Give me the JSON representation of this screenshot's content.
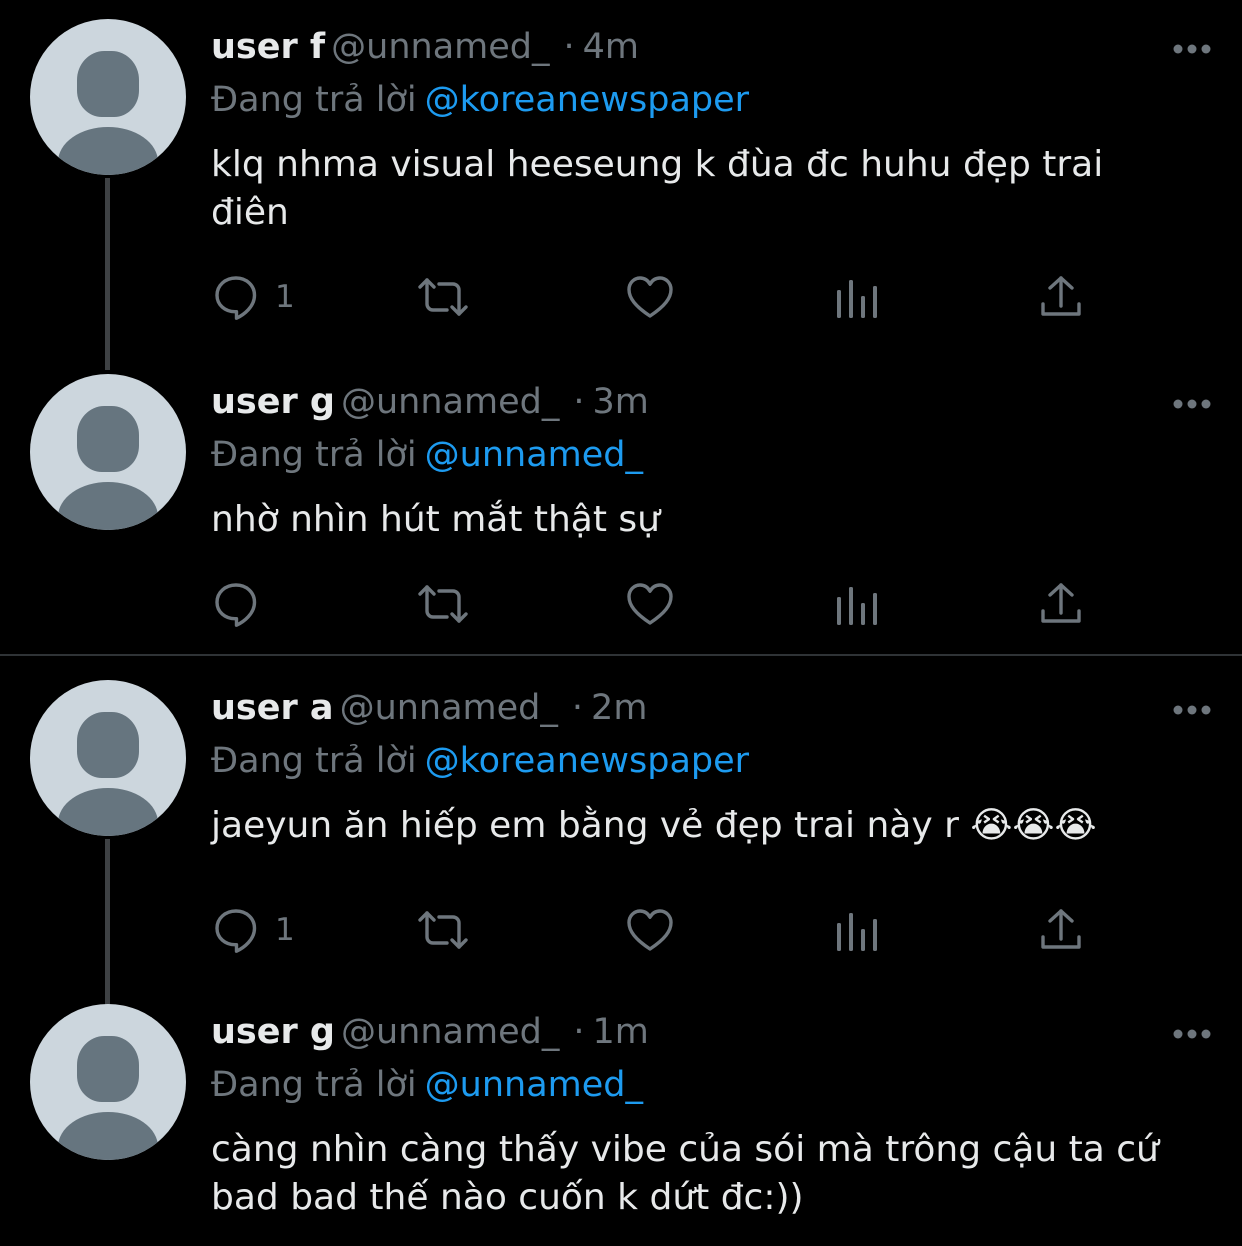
{
  "tweets": [
    {
      "name": "user f",
      "handle": "@unnamed_",
      "time": "4m",
      "reply_prefix": "Đang trả lời",
      "reply_to": "@koreanewspaper",
      "text": "klq nhma visual heeseung k đùa đc huhu đẹp trai điên",
      "reply_count": "1"
    },
    {
      "name": "user g",
      "handle": "@unnamed_",
      "time": "3m",
      "reply_prefix": "Đang trả lời",
      "reply_to": "@unnamed_",
      "text": "nhờ nhìn hút mắt thật sự",
      "reply_count": ""
    },
    {
      "name": "user a",
      "handle": "@unnamed_",
      "time": "2m",
      "reply_prefix": "Đang trả lời",
      "reply_to": "@koreanewspaper",
      "text": "jaeyun ăn hiếp em bằng vẻ đẹp trai này r 😭😭😭",
      "reply_count": "1"
    },
    {
      "name": "user g",
      "handle": "@unnamed_",
      "time": "1m",
      "reply_prefix": "Đang trả lời",
      "reply_to": "@unnamed_",
      "text": "càng nhìn càng thấy vibe của sói mà trông cậu ta cứ bad bad thế nào cuốn k dứt đc:))",
      "reply_count": ""
    }
  ],
  "separator": "·",
  "icons": {
    "avatar": "default-avatar",
    "more": "more-horizontal-icon",
    "reply": "reply-bubble-icon",
    "retweet": "retweet-icon",
    "like": "heart-icon",
    "analytics": "analytics-icon",
    "share": "share-upload-icon"
  },
  "colors": {
    "background": "#000000",
    "text": "#e7e9ea",
    "muted": "#6e767d",
    "mention": "#1d9bf0",
    "avatar_bg": "#ccd6dd",
    "avatar_fg": "#66757f"
  }
}
